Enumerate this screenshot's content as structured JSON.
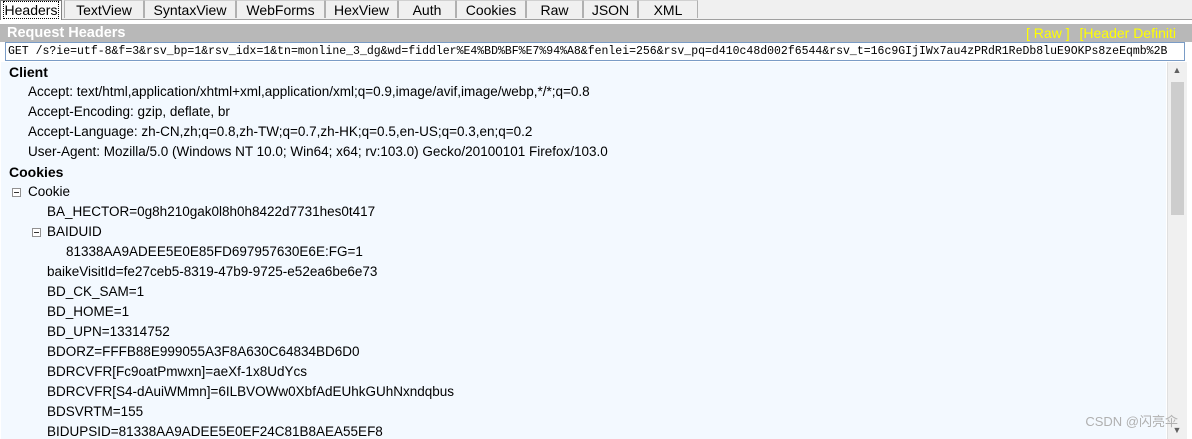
{
  "tabs": [
    "Headers",
    "TextView",
    "SyntaxView",
    "WebForms",
    "HexView",
    "Auth",
    "Cookies",
    "Raw",
    "JSON",
    "XML"
  ],
  "header": {
    "title": "Request Headers",
    "raw_link": "[ Raw ]",
    "header_def_link": "[Header Definiti"
  },
  "request_line": "GET /s?ie=utf-8&f=3&rsv_bp=1&rsv_idx=1&tn=monline_3_dg&wd=fiddler%E4%BD%BF%E7%94%A8&fenlei=256&rsv_pq=d410c48d002f6544&rsv_t=16c9GIjIWx7au4zPRdR1ReDb8luE9OKPs8zeEqmb%2B",
  "tree": {
    "client_group": "Client",
    "client_items": [
      "Accept: text/html,application/xhtml+xml,application/xml;q=0.9,image/avif,image/webp,*/*;q=0.8",
      "Accept-Encoding: gzip, deflate, br",
      "Accept-Language: zh-CN,zh;q=0.8,zh-TW;q=0.7,zh-HK;q=0.5,en-US;q=0.3,en;q=0.2",
      "User-Agent: Mozilla/5.0 (Windows NT 10.0; Win64; x64; rv:103.0) Gecko/20100101 Firefox/103.0"
    ],
    "cookies_group": "Cookies",
    "cookie_node": "Cookie",
    "cookie_first": "BA_HECTOR=0g8h210gak0l8h0h8422d7731hes0t417",
    "baiduid_node": "BAIDUID",
    "baiduid_value": "81338AA9ADEE5E0E85FD697957630E6E:FG=1",
    "cookie_rest": [
      "baikeVisitId=fe27ceb5-8319-47b9-9725-e52ea6be6e73",
      "BD_CK_SAM=1",
      "BD_HOME=1",
      "BD_UPN=13314752",
      "BDORZ=FFFB88E999055A3F8A630C64834BD6D0",
      "BDRCVFR[Fc9oatPmwxn]=aeXf-1x8UdYcs",
      "BDRCVFR[S4-dAuiWMmn]=6ILBVOWw0XbfAdEUhkGUhNxndqbus",
      "BDSVRTM=155",
      "BIDUPSID=81338AA9ADEE5E0EF24C81B8AEA55EF8"
    ]
  },
  "watermark": "CSDN @闪亮伞"
}
